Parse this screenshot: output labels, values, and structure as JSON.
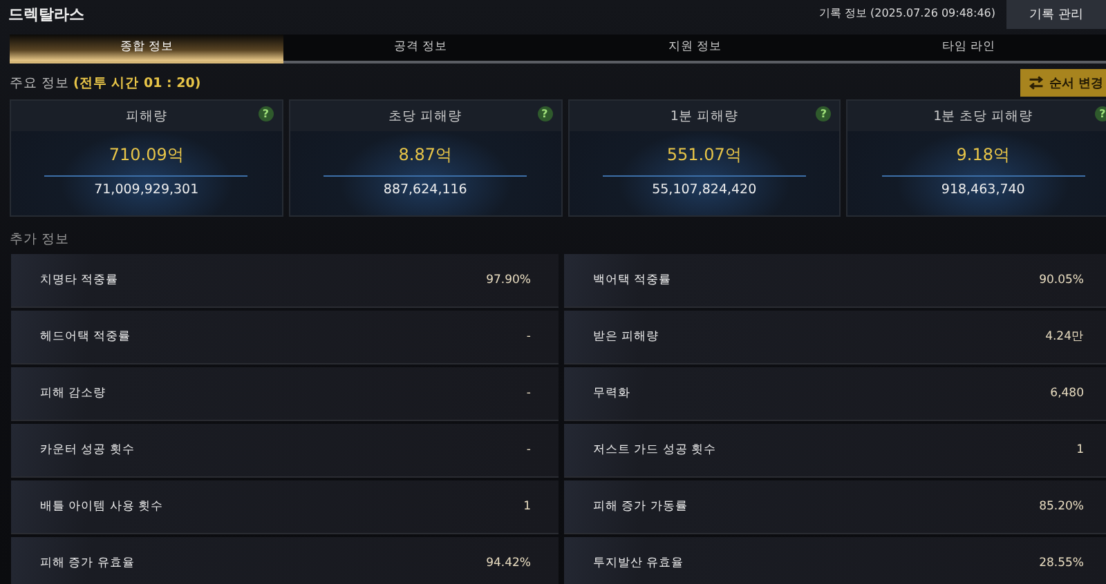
{
  "window": {
    "title": "드렉탈라스"
  },
  "record_info": "기록 정보 (2025.07.26 09:48:46)",
  "manage_button": "기록 관리",
  "tabs": [
    {
      "label": "종합 정보",
      "selected": true
    },
    {
      "label": "공격 정보",
      "selected": false
    },
    {
      "label": "지원 정보",
      "selected": false
    },
    {
      "label": "타임 라인",
      "selected": false
    }
  ],
  "main_section": {
    "title": "주요 정보",
    "highlight": "(전투 시간 01 : 20)"
  },
  "reorder_button": "순서 변경",
  "cards": [
    {
      "label": "피해량",
      "help": "?",
      "value": "710.09억",
      "exact": "71,009,929,301"
    },
    {
      "label": "초당 피해량",
      "help": "?",
      "value": "8.87억",
      "exact": "887,624,116"
    },
    {
      "label": "1분 피해량",
      "help": "?",
      "value": "551.07억",
      "exact": "55,107,824,420"
    },
    {
      "label": "1분 초당 피해량",
      "help": "?",
      "value": "9.18억",
      "exact": "918,463,740"
    }
  ],
  "extra_section": {
    "title": "추가 정보"
  },
  "stats": [
    {
      "label": "치명타 적중률",
      "value": "97.90%"
    },
    {
      "label": "백어택 적중률",
      "value": "90.05%"
    },
    {
      "label": "헤드어택 적중률",
      "value": "-"
    },
    {
      "label": "받은 피해량",
      "value": "4.24만"
    },
    {
      "label": "피해 감소량",
      "value": "-"
    },
    {
      "label": "무력화",
      "value": "6,480"
    },
    {
      "label": "카운터 성공 횟수",
      "value": "-"
    },
    {
      "label": "저스트 가드 성공 횟수",
      "value": "1"
    },
    {
      "label": "배틀 아이템 사용 횟수",
      "value": "1"
    },
    {
      "label": "피해 증가 가동률",
      "value": "85.20%"
    },
    {
      "label": "피해 증가 유효율",
      "value": "94.42%"
    },
    {
      "label": "투지발산 유효율",
      "value": "28.55%"
    }
  ]
}
